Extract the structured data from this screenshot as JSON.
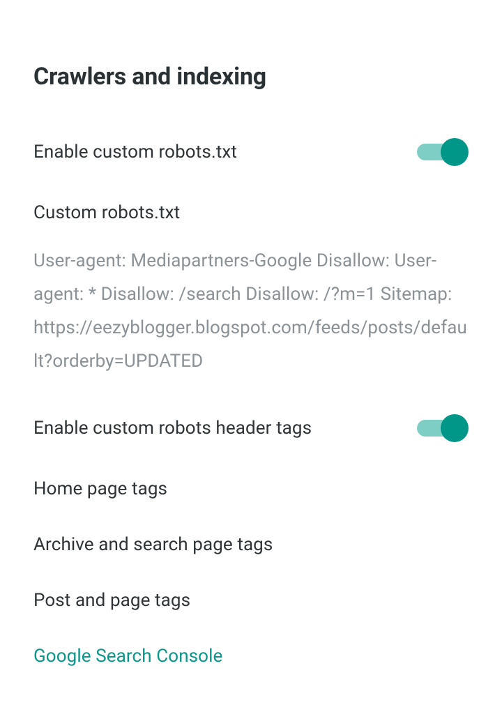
{
  "section": {
    "title": "Crawlers and indexing"
  },
  "enableRobots": {
    "label": "Enable custom robots.txt",
    "on": true
  },
  "customRobots": {
    "title": "Custom robots.txt",
    "body": "User-agent: Mediapartners-Google Disallow: User-agent: * Disallow: /search Disallow: /?m=1 Sitemap: https://eezyblogger.blogspot.com/feeds/posts/default?orderby=UPDATED"
  },
  "enableHeaderTags": {
    "label": "Enable custom robots header tags",
    "on": true
  },
  "items": {
    "homePageTags": "Home page tags",
    "archiveSearchTags": "Archive and search page tags",
    "postPageTags": "Post and page tags"
  },
  "link": {
    "googleSearchConsole": "Google Search Console"
  },
  "colors": {
    "accent": "#009688",
    "accentTrack": "#7fcec5",
    "textPrimary": "#2d3336",
    "textSecondary": "#8a9297"
  }
}
